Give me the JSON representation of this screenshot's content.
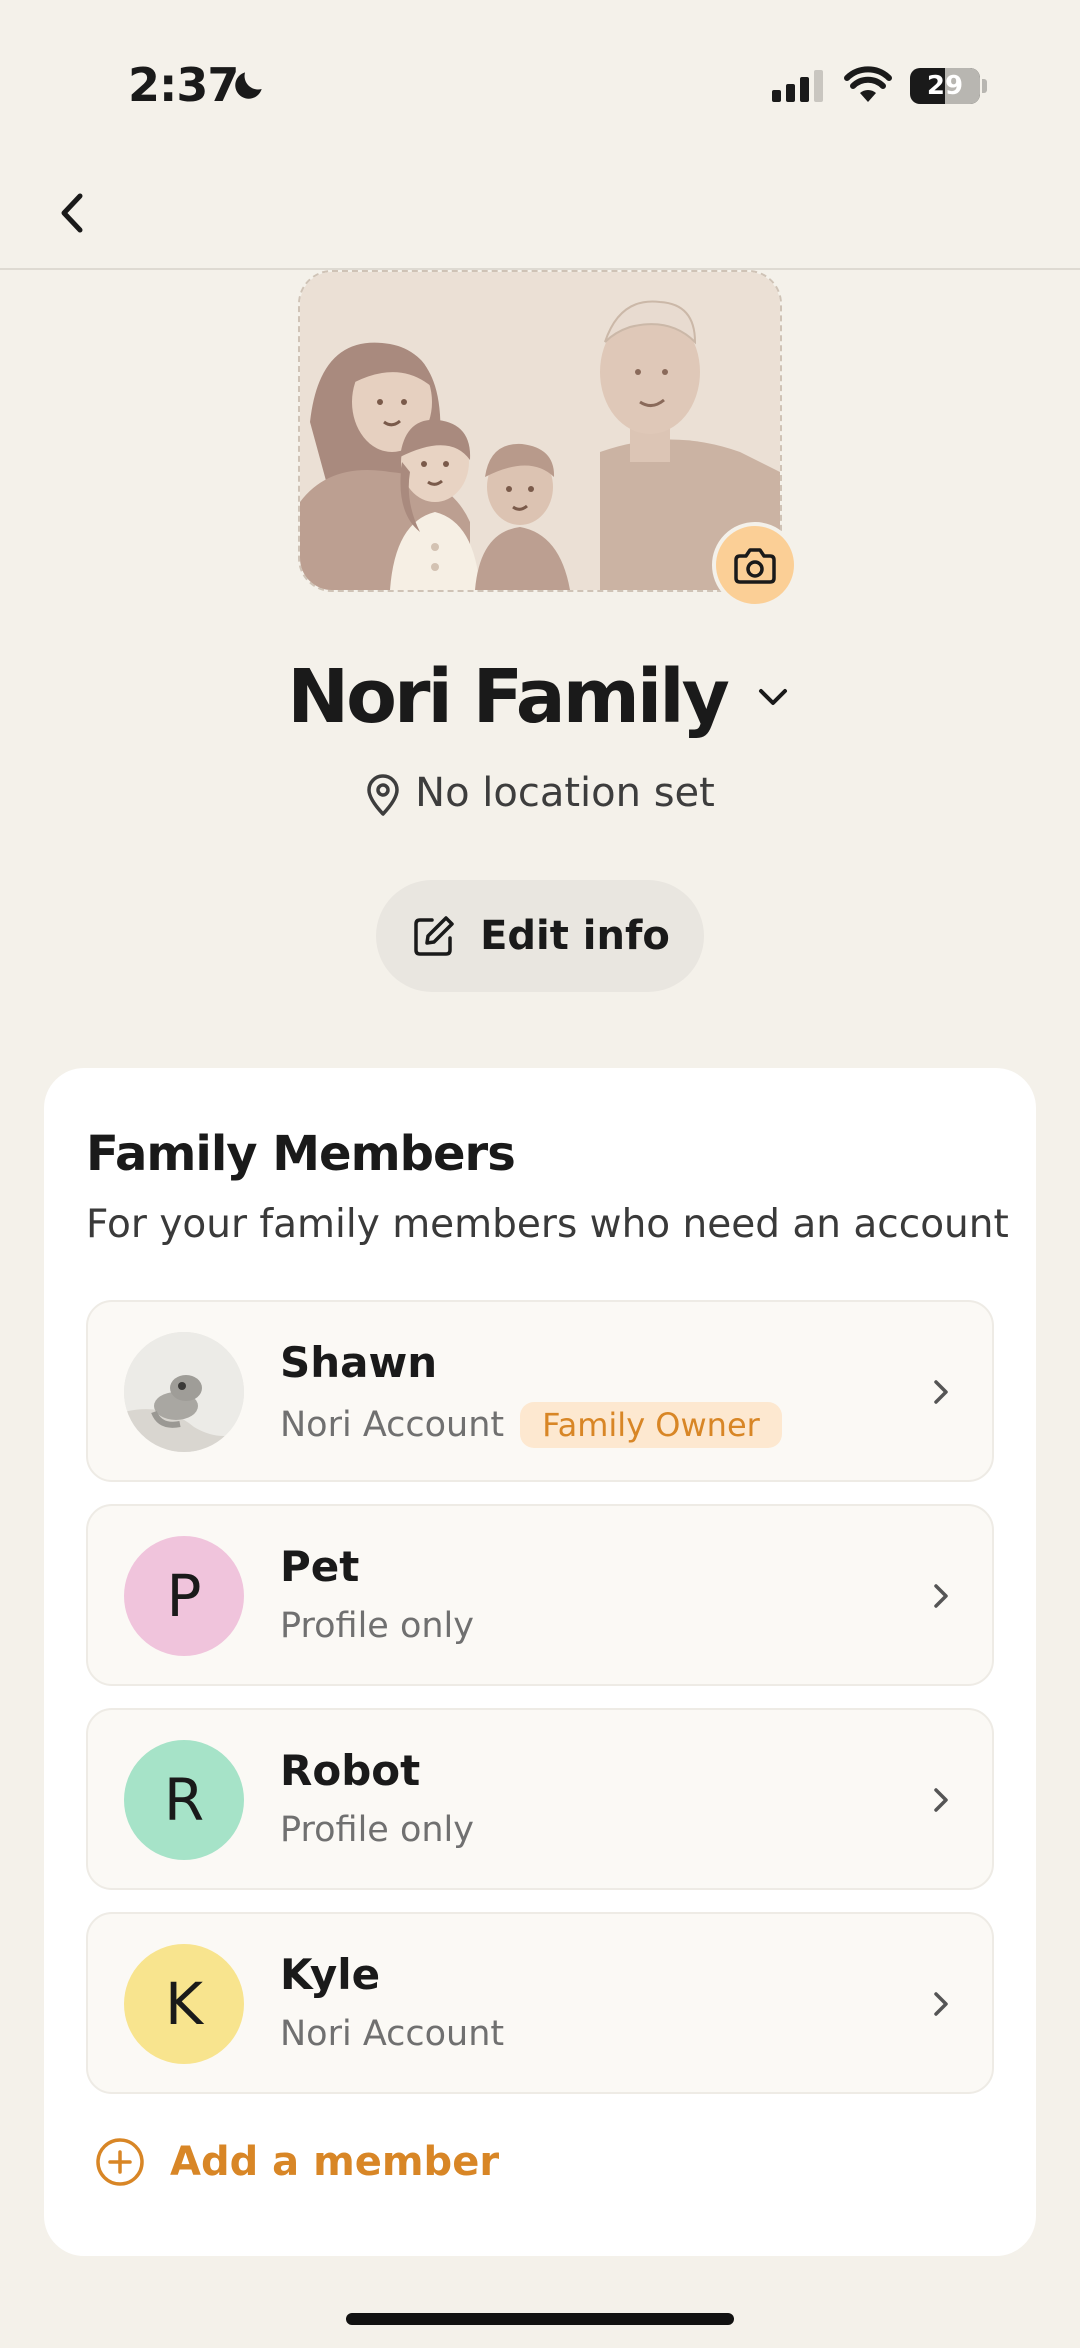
{
  "status_bar": {
    "time": "2:37",
    "battery_level": "29",
    "icons": [
      "moon-icon",
      "signal-icon",
      "wifi-icon",
      "battery-icon"
    ]
  },
  "nav": {
    "back_icon": "chevron-left-icon"
  },
  "family": {
    "name": "Nori Family",
    "location": "No location set",
    "edit_label": "Edit info"
  },
  "members_card": {
    "title": "Family Members",
    "subtitle": "For your family members who need an account",
    "members": [
      {
        "name": "Shawn",
        "subtitle": "Nori Account",
        "badge": "Family Owner",
        "avatar_type": "photo"
      },
      {
        "name": "Pet",
        "subtitle": "Profile only",
        "initial": "P",
        "avatar_color": "#f0c4dc"
      },
      {
        "name": "Robot",
        "subtitle": "Profile only",
        "initial": "R",
        "avatar_color": "#a6e3c8"
      },
      {
        "name": "Kyle",
        "subtitle": "Nori Account",
        "initial": "K",
        "avatar_color": "#f8e48e"
      }
    ],
    "add_label": "Add a member"
  },
  "colors": {
    "background": "#f4f1ea",
    "accent": "#d88626",
    "badge_bg": "#fde8d0",
    "camera_button": "#fbcf96"
  }
}
